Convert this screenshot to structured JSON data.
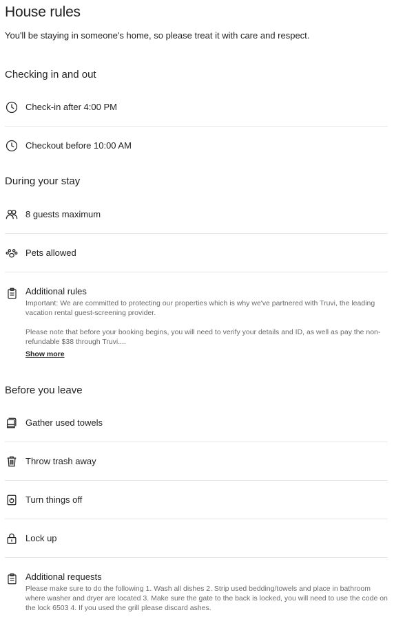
{
  "header": {
    "title": "House rules",
    "subtitle": "You'll be staying in someone's home, so please treat it with care and respect."
  },
  "checking": {
    "title": "Checking in and out",
    "items": [
      {
        "icon": "clock-icon",
        "label": "Check-in after 4:00 PM"
      },
      {
        "icon": "clock-icon",
        "label": "Checkout before 10:00 AM"
      }
    ]
  },
  "during": {
    "title": "During your stay",
    "items": [
      {
        "icon": "people-icon",
        "label": "8 guests maximum"
      },
      {
        "icon": "paw-icon",
        "label": "Pets allowed"
      }
    ],
    "additional_rules": {
      "icon": "clipboard-icon",
      "label": "Additional rules",
      "paragraph_1": "Important: We are committed to protecting our properties which is why we've partnered with Truvi, the leading vacation rental guest-screening provider.",
      "paragraph_2": "Please note that before your booking begins, you will need to verify your details and ID, as well as pay the non-refundable $38 through Truvi....",
      "show_more": "Show more"
    }
  },
  "before": {
    "title": "Before you leave",
    "items": [
      {
        "icon": "towel-icon",
        "label": "Gather used towels"
      },
      {
        "icon": "trash-icon",
        "label": "Throw trash away"
      },
      {
        "icon": "power-icon",
        "label": "Turn things off"
      },
      {
        "icon": "lock-icon",
        "label": "Lock up"
      }
    ],
    "additional_requests": {
      "icon": "clipboard-icon",
      "label": "Additional requests",
      "text": "Please make sure to do the following 1. Wash all dishes 2. Strip used bedding/towels and place in bathroom where washer and dryer are located 3. Make sure the gate to the back is locked, you will need to use the code on the lock 6503 4. If you used the grill please discard ashes."
    }
  }
}
